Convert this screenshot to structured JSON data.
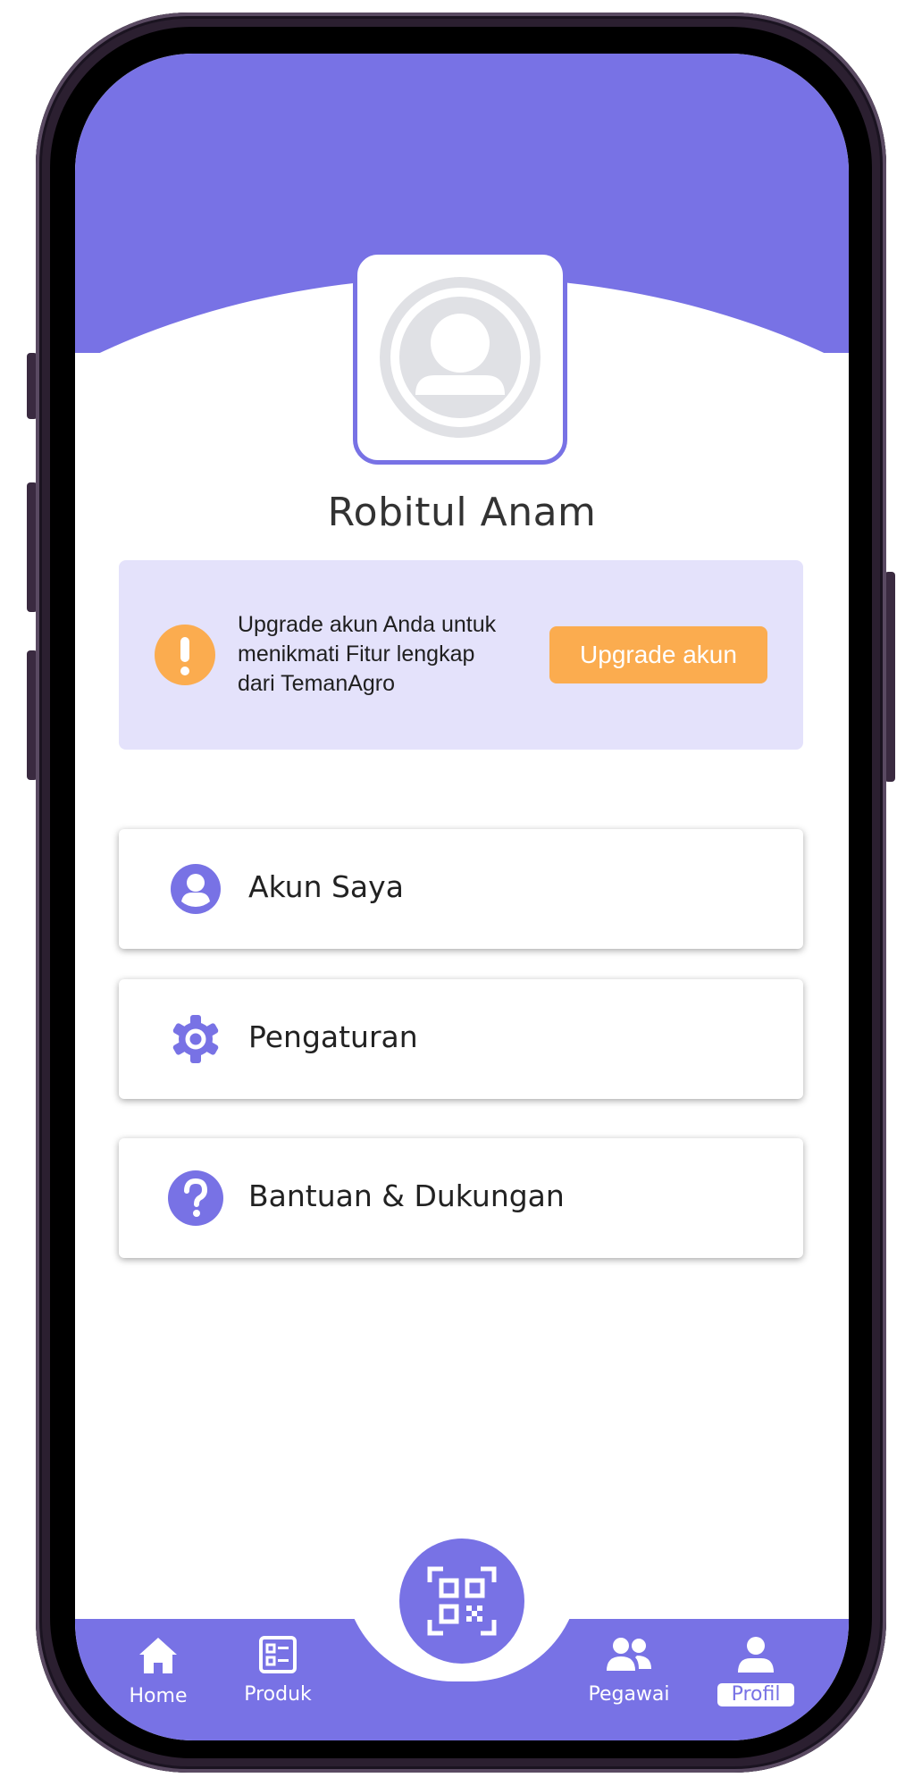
{
  "profile": {
    "name": "Robitul Anam"
  },
  "upgrade_banner": {
    "message_lines": [
      "Upgrade akun Anda untuk",
      "menikmati Fitur lengkap",
      "dari TemanAgro"
    ],
    "button_label": "Upgrade akun"
  },
  "menu": {
    "items": [
      {
        "label": "Akun Saya",
        "icon": "user-circle-icon"
      },
      {
        "label": "Pengaturan",
        "icon": "gear-icon"
      },
      {
        "label": "Bantuan & Dukungan",
        "icon": "question-circle-icon"
      }
    ]
  },
  "bottom_nav": {
    "items": [
      {
        "label": "Home",
        "icon": "home-icon"
      },
      {
        "label": "Produk",
        "icon": "product-list-icon"
      },
      {
        "label": "Pegawai",
        "icon": "users-icon"
      },
      {
        "label": "Profil",
        "icon": "profile-icon",
        "active": true
      }
    ],
    "center_action_icon": "qr-code-icon"
  },
  "colors": {
    "primary": "#7872e5",
    "accent": "#fbac4f",
    "banner_bg": "#e4e2fb"
  }
}
